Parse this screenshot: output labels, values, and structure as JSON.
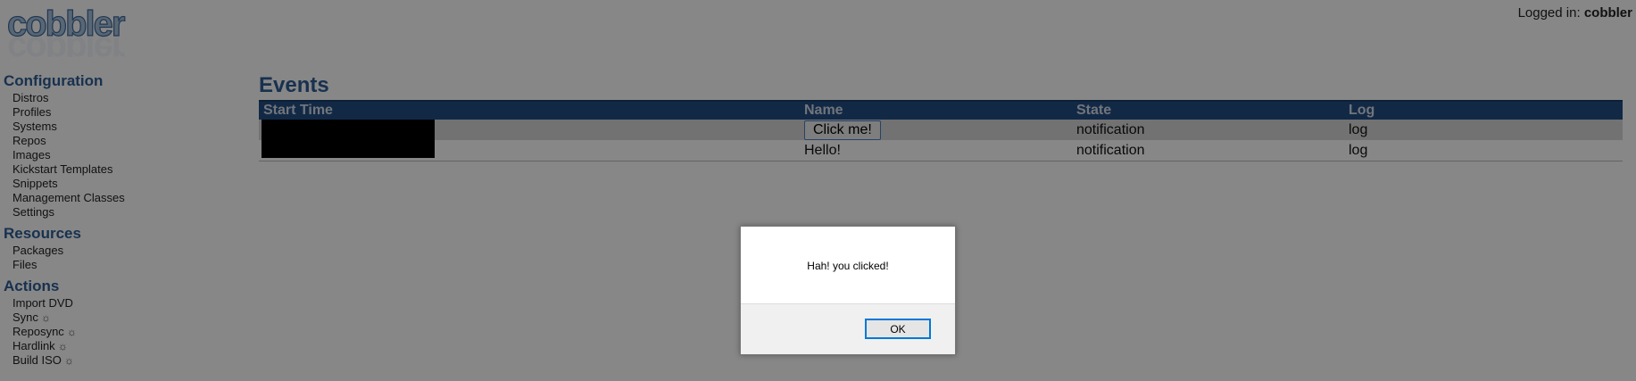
{
  "header": {
    "logo_text": "cobbler",
    "login_label": "Logged in:",
    "login_user": "cobbler"
  },
  "sidebar": {
    "configuration": {
      "title": "Configuration",
      "items": [
        "Distros",
        "Profiles",
        "Systems",
        "Repos",
        "Images",
        "Kickstart Templates",
        "Snippets",
        "Management Classes",
        "Settings"
      ]
    },
    "resources": {
      "title": "Resources",
      "items": [
        "Packages",
        "Files"
      ]
    },
    "actions": {
      "title": "Actions",
      "items": [
        "Import DVD",
        "Sync",
        "Reposync",
        "Hardlink",
        "Build ISO"
      ],
      "gear_symbol": "☼"
    }
  },
  "main": {
    "title": "Events",
    "columns": [
      "Start Time",
      "Name",
      "State",
      "Log"
    ],
    "rows": [
      {
        "start_time": "",
        "name": "Click me!",
        "state": "notification",
        "log": "log"
      },
      {
        "start_time": "",
        "name": "Hello!",
        "state": "notification",
        "log": "log"
      }
    ]
  },
  "dialog": {
    "message": "Hah! you clicked!",
    "ok_label": "OK"
  }
}
